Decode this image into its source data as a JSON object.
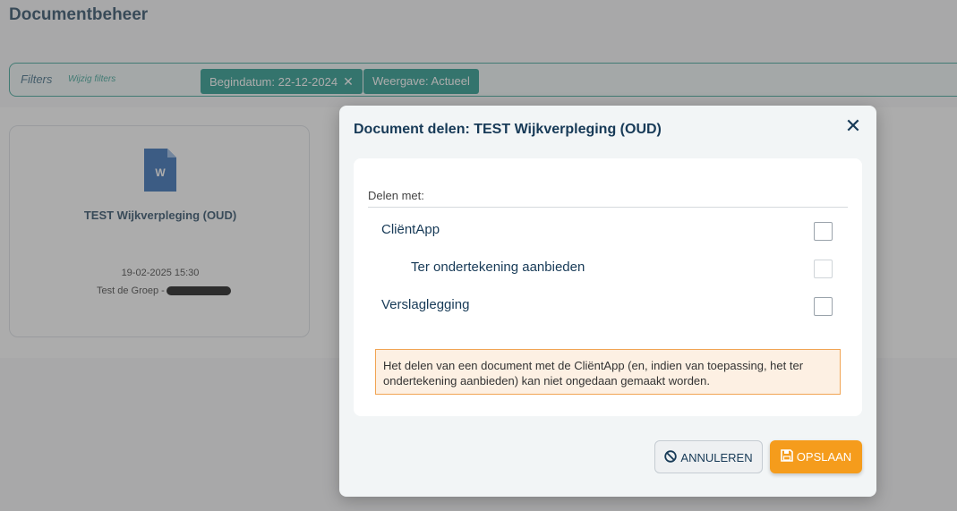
{
  "page": {
    "title": "Documentbeheer"
  },
  "filters": {
    "label": "Filters",
    "edit_link": "Wijzig filters",
    "chips": [
      {
        "label": "Begindatum: 22-12-2024",
        "removable": true
      },
      {
        "label": "Weergave: Actueel",
        "removable": false
      }
    ]
  },
  "document_card": {
    "icon": "word-document-icon",
    "icon_letter": "W",
    "title": "TEST Wijkverpleging (OUD)",
    "date": "19-02-2025 15:30",
    "author_prefix": "Test de Groep -"
  },
  "modal": {
    "title": "Document delen: TEST Wijkverpleging (OUD)",
    "close_icon": "close-icon",
    "share_with_label": "Delen met:",
    "options": [
      {
        "label": "CliëntApp",
        "checked": false,
        "enabled": true
      },
      {
        "label": "Ter ondertekening aanbieden",
        "checked": false,
        "enabled": false
      },
      {
        "label": "Verslaglegging",
        "checked": false,
        "enabled": true
      }
    ],
    "warning": "Het delen van een document met de CliëntApp (en, indien van toepassing, het ter ondertekening aanbieden) kan niet ongedaan gemaakt worden.",
    "buttons": {
      "cancel": "ANNULEREN",
      "save": "OPSLAAN"
    }
  },
  "colors": {
    "primary_text": "#173a57",
    "teal": "#0f8f80",
    "save_orange": "#f59c1c",
    "warning_border": "#f1a453",
    "warning_bg": "#fdf0e3"
  }
}
